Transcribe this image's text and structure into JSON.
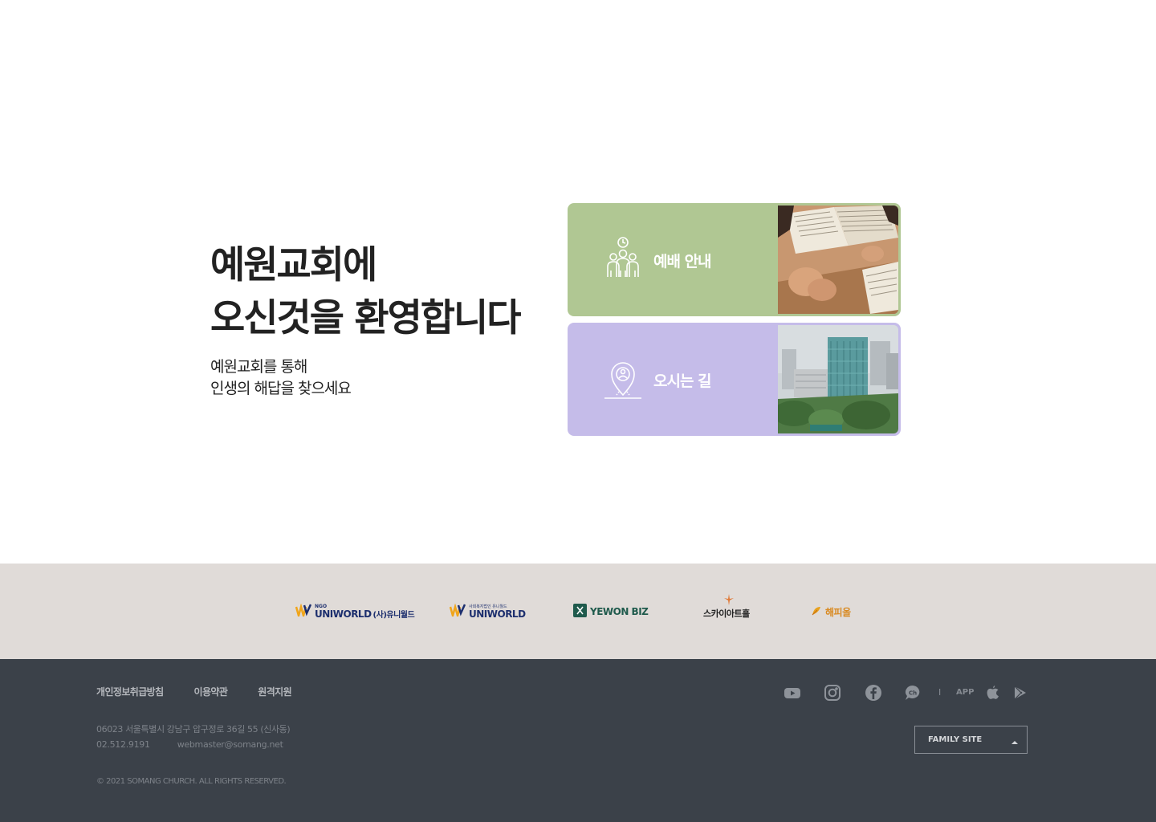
{
  "hero": {
    "title_line1": "예원교회에",
    "title_line2": "오신것을 환영합니다",
    "sub_line1": "예원교회를 통해",
    "sub_line2": "인생의 해답을 찾으세요"
  },
  "cards": {
    "worship": {
      "label": "예배 안내",
      "icon": "people-clock-icon",
      "color": "#b0c793"
    },
    "location": {
      "label": "오시는 길",
      "icon": "map-pin-icon",
      "color": "#c5bce9"
    }
  },
  "partners": [
    {
      "sup": "NGO",
      "name": "UNIWORLD",
      "sub": "(사)유니월드"
    },
    {
      "sup": "사회복지법인 유니월드",
      "name": "UNIWORLD"
    },
    {
      "name": "YEWON BIZ"
    },
    {
      "name": "스카이아트홀"
    },
    {
      "name": "해피올"
    }
  ],
  "footer": {
    "links": [
      "개인정보취급방침",
      "이용약관",
      "원격지원"
    ],
    "address": "06023 서울특별시 강남구 압구정로 36길 55 (신사동)",
    "phone": "02.512.9191",
    "email": "webmaster@somang.net",
    "copyright": "© 2021 SOMANG CHURCH. ALL RIGHTS RESERVED.",
    "separator": "I",
    "app_label": "APP",
    "family_site": "FAMILY SITE",
    "social_icons": [
      "youtube-icon",
      "instagram-icon",
      "facebook-icon",
      "kakao-channel-icon",
      "apple-icon",
      "google-play-icon"
    ]
  },
  "colors": {
    "footer_bg": "#3b4149",
    "partner_bg": "#e0dbd8",
    "worship_card": "#b0c793",
    "location_card": "#c5bce9"
  }
}
